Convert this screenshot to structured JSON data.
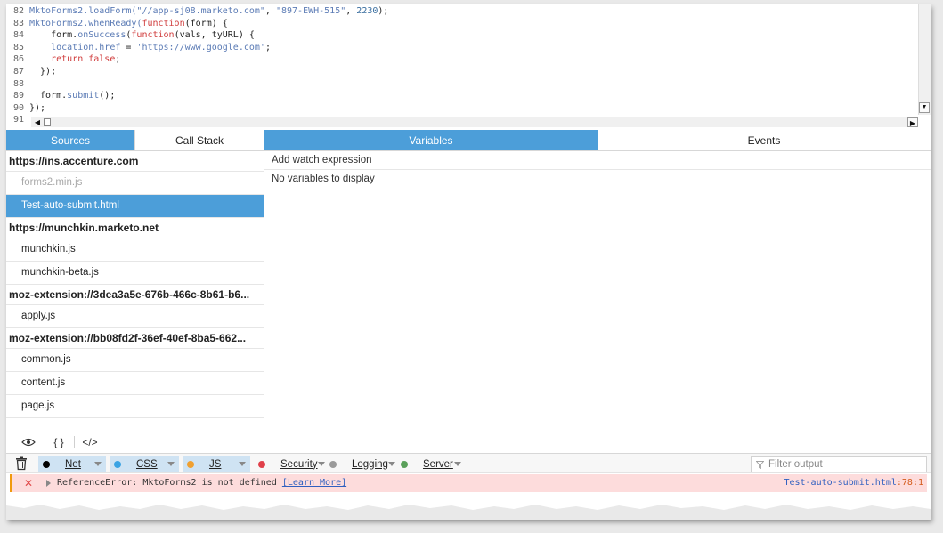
{
  "editor": {
    "lines": [
      {
        "num": "82",
        "tokens": [
          [
            "fn",
            "MktoForms2.loadForm("
          ],
          [
            "str",
            "\"//app-sj08.marketo.com\""
          ],
          [
            "ct",
            ", "
          ],
          [
            "str",
            "\"897-EWH-515\""
          ],
          [
            "ct",
            ", "
          ],
          [
            "num",
            "2230"
          ],
          [
            "ct",
            ");"
          ]
        ]
      },
      {
        "num": "83",
        "tokens": [
          [
            "fn",
            "MktoForms2.whenReady("
          ],
          [
            "kw",
            "function"
          ],
          [
            "ct",
            "(form) {"
          ]
        ]
      },
      {
        "num": "84",
        "tokens": [
          [
            "ct",
            "    form."
          ],
          [
            "fn",
            "onSuccess"
          ],
          [
            "ct",
            "("
          ],
          [
            "kw",
            "function"
          ],
          [
            "ct",
            "(vals, tyURL) {"
          ]
        ]
      },
      {
        "num": "85",
        "tokens": [
          [
            "ct",
            "    "
          ],
          [
            "fn",
            "location.href"
          ],
          [
            "ct",
            " = "
          ],
          [
            "str",
            "'https://www.google.com'"
          ],
          [
            "ct",
            ";"
          ]
        ]
      },
      {
        "num": "86",
        "tokens": [
          [
            "ct",
            "    "
          ],
          [
            "kw",
            "return false"
          ],
          [
            "ct",
            ";"
          ]
        ]
      },
      {
        "num": "87",
        "tokens": [
          [
            "ct",
            "  });"
          ]
        ]
      },
      {
        "num": "88",
        "tokens": []
      },
      {
        "num": "89",
        "tokens": [
          [
            "ct",
            "  form."
          ],
          [
            "fn",
            "submit"
          ],
          [
            "ct",
            "();"
          ]
        ]
      },
      {
        "num": "90",
        "tokens": [
          [
            "ct",
            "});"
          ]
        ]
      },
      {
        "num": "91",
        "tokens": []
      }
    ]
  },
  "left_tabs": [
    "Sources",
    "Call Stack"
  ],
  "right_tabs": [
    "Variables",
    "Events"
  ],
  "sources": [
    {
      "kind": "group",
      "label": "https://ins.accenture.com"
    },
    {
      "kind": "item",
      "label": "forms2.min.js",
      "state": "dim"
    },
    {
      "kind": "item",
      "label": "Test-auto-submit.html",
      "state": "selected"
    },
    {
      "kind": "group",
      "label": "https://munchkin.marketo.net"
    },
    {
      "kind": "item",
      "label": "munchkin.js"
    },
    {
      "kind": "item",
      "label": "munchkin-beta.js"
    },
    {
      "kind": "group",
      "label": "moz-extension://3dea3a5e-676b-466c-8b61-b6..."
    },
    {
      "kind": "item",
      "label": "apply.js"
    },
    {
      "kind": "group",
      "label": "moz-extension://bb08fd2f-36ef-40ef-8ba5-662..."
    },
    {
      "kind": "item",
      "label": "common.js"
    },
    {
      "kind": "item",
      "label": "content.js"
    },
    {
      "kind": "item",
      "label": "page.js"
    }
  ],
  "left_footer": {
    "eye_icon": "eye-icon",
    "pretty_print": "{ }",
    "blackbox": "</>"
  },
  "variables": {
    "watch_label": "Add watch expression",
    "empty_text": "No variables to display"
  },
  "console_filters": [
    {
      "label": "Net",
      "color": "#000000",
      "active": true
    },
    {
      "label": "CSS",
      "color": "#3aa3e3",
      "active": true
    },
    {
      "label": "JS",
      "color": "#f0a030",
      "active": true
    },
    {
      "label": "Security",
      "color": "#e0404a",
      "active": false
    },
    {
      "label": "Logging",
      "color": "#9a9a9a",
      "active": false
    },
    {
      "label": "Server",
      "color": "#5aa05a",
      "active": false
    }
  ],
  "filter_output": {
    "placeholder": "Filter output"
  },
  "console_message": {
    "text": "ReferenceError: MktoForms2 is not defined ",
    "link": "[Learn More]",
    "location_file": "Test-auto-submit.html",
    "location_pos": ":78:1"
  }
}
